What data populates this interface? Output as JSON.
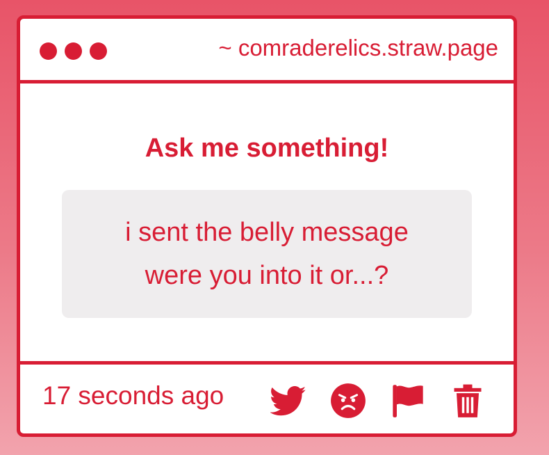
{
  "window": {
    "url": "~ comraderelics.straw.page",
    "dots": [
      "close-dot",
      "minimize-dot",
      "maximize-dot"
    ]
  },
  "main": {
    "heading": "Ask me something!",
    "question_lines": [
      "i sent the belly message",
      "were you into it or...?"
    ]
  },
  "footer": {
    "timestamp": "17 seconds ago",
    "actions": [
      "twitter-icon",
      "angry-face-icon",
      "flag-icon",
      "trash-icon"
    ]
  },
  "colors": {
    "accent": "#d81d34",
    "box_bg": "#efedee",
    "background_top": "#e85468",
    "background_bottom": "#f2a3ad"
  }
}
